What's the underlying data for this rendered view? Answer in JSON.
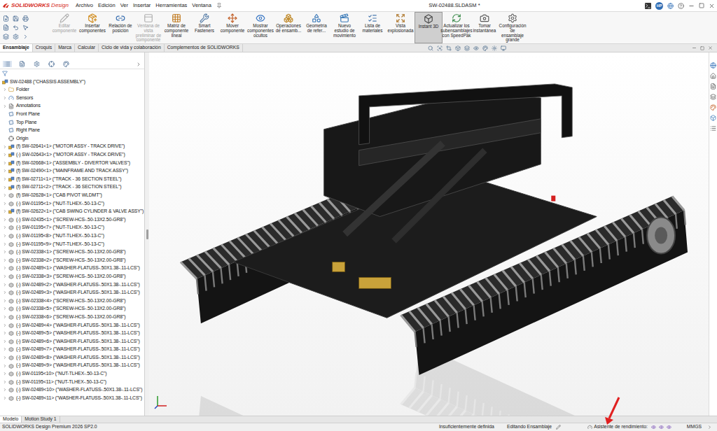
{
  "window": {
    "title": "SW-02488.SLDASM *"
  },
  "app": {
    "brand": "SOLIDWORKS",
    "edition": "Design"
  },
  "menus": [
    "Archivo",
    "Edición",
    "Ver",
    "Insertar",
    "Herramientas",
    "Ventana"
  ],
  "user": {
    "initials": "HP"
  },
  "ribbon": [
    {
      "label": "Editar componente",
      "disabled": true,
      "selected": false
    },
    {
      "label": "Insertar componentes",
      "disabled": false,
      "selected": false
    },
    {
      "label": "Relación de posición",
      "disabled": false,
      "selected": false
    },
    {
      "label": "Ventana de vista preliminar de componente",
      "disabled": true,
      "selected": false
    },
    {
      "label": "Matriz de componente lineal",
      "disabled": false,
      "selected": false
    },
    {
      "label": "Smart Fasteners",
      "disabled": false,
      "selected": false
    },
    {
      "label": "Mover componente",
      "disabled": false,
      "selected": false
    },
    {
      "label": "Mostrar componentes ocultos",
      "disabled": false,
      "selected": false
    },
    {
      "label": "Operaciones de ensamb...",
      "disabled": false,
      "selected": false
    },
    {
      "label": "Geometría de refer...",
      "disabled": false,
      "selected": false
    },
    {
      "label": "Nuevo estudio de movimiento",
      "disabled": false,
      "selected": false
    },
    {
      "label": "Lista de materiales",
      "disabled": false,
      "selected": false
    },
    {
      "label": "Vista explosionada",
      "disabled": false,
      "selected": false
    },
    {
      "label": "Instant 3D",
      "disabled": false,
      "selected": true
    },
    {
      "label": "Actualizar los subensamblajes con SpeedPak",
      "disabled": false,
      "selected": false
    },
    {
      "label": "Tomar instantánea",
      "disabled": false,
      "selected": false
    },
    {
      "label": "Configuración de ensamblaje grande",
      "disabled": false,
      "selected": false
    }
  ],
  "command_tabs": [
    {
      "label": "Ensamblaje",
      "selected": true
    },
    {
      "label": "Croquis",
      "selected": false
    },
    {
      "label": "Marca",
      "selected": false
    },
    {
      "label": "Calcular",
      "selected": false
    },
    {
      "label": "Ciclo de vida y colaboración",
      "selected": false
    },
    {
      "label": "Complementos de SOLIDWORKS",
      "selected": false
    }
  ],
  "feature_tree": {
    "root": "SW-02488 (\"CHASSIS ASSEMBLY\")",
    "items": [
      {
        "label": "Folder",
        "kind": "folder",
        "expandable": true
      },
      {
        "label": "Sensors",
        "kind": "sensors",
        "expandable": true
      },
      {
        "label": "Annotations",
        "kind": "annotations",
        "expandable": true
      },
      {
        "label": "Front Plane",
        "kind": "plane",
        "expandable": false
      },
      {
        "label": "Top Plane",
        "kind": "plane",
        "expandable": false
      },
      {
        "label": "Right Plane",
        "kind": "plane",
        "expandable": false
      },
      {
        "label": "Origin",
        "kind": "origin",
        "expandable": false
      },
      {
        "label": "(f) SW-02641<1> (\"MOTOR ASSY - TRACK DRIVE\")",
        "kind": "assembly",
        "expandable": true
      },
      {
        "label": "(-) SW-02643<1> (\"MOTOR ASSY - TRACK DRIVE\")",
        "kind": "assembly",
        "expandable": true
      },
      {
        "label": "(f) SW-02668<1> (\"ASSEMBLY - DIVERTOR VALVES\")",
        "kind": "assembly",
        "expandable": true
      },
      {
        "label": "(f) SW-02490<1> (\"MAINFRAME AND TRACK ASSY\")",
        "kind": "assembly",
        "expandable": true
      },
      {
        "label": "(f) SW-02711<1> (\"TRACK - 36 SECTION STEEL\")",
        "kind": "assembly",
        "expandable": true
      },
      {
        "label": "(f) SW-02711<2> (\"TRACK - 36 SECTION STEEL\")",
        "kind": "assembly",
        "expandable": true
      },
      {
        "label": "(f) SW-02628<1> (\"CAB PIVOT WLDMT\")",
        "kind": "part",
        "expandable": true
      },
      {
        "label": "(-) SW-01195<1> (\"NUT-TLHEX-.50-13-C\")",
        "kind": "part",
        "expandable": true
      },
      {
        "label": "(f) SW-02622<1> (\"CAB SWING CYLINDER & VALVE ASSY\")",
        "kind": "assembly",
        "expandable": true
      },
      {
        "label": "(-) SW-02435<1> (\"SCREW-HCS-.50-13X2.50-GR8\")",
        "kind": "part",
        "expandable": true
      },
      {
        "label": "(-) SW-01195<7> (\"NUT-TLHEX-.50-13-C\")",
        "kind": "part",
        "expandable": true
      },
      {
        "label": "(-) SW-01195<8> (\"NUT-TLHEX-.50-13-C\")",
        "kind": "part",
        "expandable": true
      },
      {
        "label": "(-) SW-01195<9> (\"NUT-TLHEX-.50-13-C\")",
        "kind": "part",
        "expandable": true
      },
      {
        "label": "(-) SW-02338<1> (\"SCREW-HCS-.50-13X2.00-GR8\")",
        "kind": "part",
        "expandable": true
      },
      {
        "label": "(-) SW-02338<2> (\"SCREW-HCS-.50-13X2.00-GR8\")",
        "kind": "part",
        "expandable": true
      },
      {
        "label": "(-) SW-02489<1> (\"WASHER-FLATUSS-.50X1.38-.11-LCS\")",
        "kind": "part",
        "expandable": true
      },
      {
        "label": "(-) SW-02338<3> (\"SCREW-HCS-.50-13X2.00-GR8\")",
        "kind": "part",
        "expandable": true
      },
      {
        "label": "(-) SW-02489<2> (\"WASHER-FLATUSS-.50X1.38-.11-LCS\")",
        "kind": "part",
        "expandable": true
      },
      {
        "label": "(-) SW-02489<3> (\"WASHER-FLATUSS-.50X1.38-.11-LCS\")",
        "kind": "part",
        "expandable": true
      },
      {
        "label": "(-) SW-02338<4> (\"SCREW-HCS-.50-13X2.00-GR8\")",
        "kind": "part",
        "expandable": true
      },
      {
        "label": "(-) SW-02338<5> (\"SCREW-HCS-.50-13X2.00-GR8\")",
        "kind": "part",
        "expandable": true
      },
      {
        "label": "(-) SW-02338<6> (\"SCREW-HCS-.50-13X2.00-GR8\")",
        "kind": "part",
        "expandable": true
      },
      {
        "label": "(-) SW-02489<4> (\"WASHER-FLATUSS-.50X1.38-.11-LCS\")",
        "kind": "part",
        "expandable": true
      },
      {
        "label": "(-) SW-02489<5> (\"WASHER-FLATUSS-.50X1.38-.11-LCS\")",
        "kind": "part",
        "expandable": true
      },
      {
        "label": "(-) SW-02489<6> (\"WASHER-FLATUSS-.50X1.38-.11-LCS\")",
        "kind": "part",
        "expandable": true
      },
      {
        "label": "(-) SW-02489<7> (\"WASHER-FLATUSS-.50X1.38-.11-LCS\")",
        "kind": "part",
        "expandable": true
      },
      {
        "label": "(-) SW-02489<8> (\"WASHER-FLATUSS-.50X1.38-.11-LCS\")",
        "kind": "part",
        "expandable": true
      },
      {
        "label": "(-) SW-02489<9> (\"WASHER-FLATUSS-.50X1.38-.11-LCS\")",
        "kind": "part",
        "expandable": true
      },
      {
        "label": "(-) SW-01195<10> (\"NUT-TLHEX-.50-13-C\")",
        "kind": "part",
        "expandable": true
      },
      {
        "label": "(-) SW-01195<11> (\"NUT-TLHEX-.50-13-C\")",
        "kind": "part",
        "expandable": true
      },
      {
        "label": "(-) SW-02489<10> (\"WASHER-FLATUSS-.50X1.38-.11-LCS\")",
        "kind": "part",
        "expandable": true
      },
      {
        "label": "(-) SW-02489<11> (\"WASHER-FLATUSS-.50X1.38-.11-LCS\")",
        "kind": "part",
        "expandable": true
      }
    ]
  },
  "model_tabs": [
    {
      "label": "Modelo",
      "selected": true
    },
    {
      "label": "Motion Study 1",
      "selected": false
    }
  ],
  "status_bar": {
    "product": "SOLIDWORKS Design Premium 2026 SP2.0",
    "definition": "Insuficientemente definida",
    "mode": "Editando Ensamblaje",
    "performance": "Asistente de rendimiento:",
    "units": "MMGS"
  }
}
